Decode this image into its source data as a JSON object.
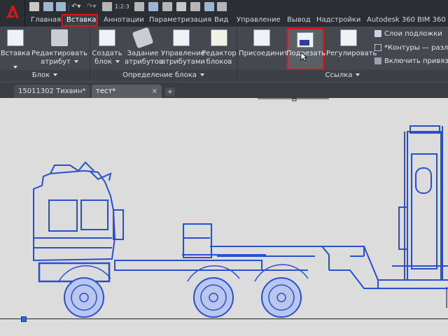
{
  "quick_access": {
    "tool_label": "1:2:3"
  },
  "tabs": [
    {
      "label": "Главная"
    },
    {
      "label": "Вставка"
    },
    {
      "label": "Аннотации"
    },
    {
      "label": "Параметризация"
    },
    {
      "label": "Вид"
    },
    {
      "label": "Управление"
    },
    {
      "label": "Вывод"
    },
    {
      "label": "Надстройки"
    },
    {
      "label": "Autodesk 360"
    },
    {
      "label": "BIM 360"
    }
  ],
  "ribbon": {
    "block_panel": {
      "title": "Блок",
      "buttons": [
        {
          "label1": "Вставка",
          "label2": ""
        },
        {
          "label1": "Редактировать",
          "label2": "атрибут"
        }
      ]
    },
    "block_def_panel": {
      "title": "Определение блока",
      "buttons": [
        {
          "label1": "Создать",
          "label2": "блок"
        },
        {
          "label1": "Задание",
          "label2": "атрибутов"
        },
        {
          "label1": "Управление",
          "label2": "атрибутами"
        },
        {
          "label1": "Редактор",
          "label2": "блоков"
        }
      ]
    },
    "reference_panel": {
      "title": "Ссылка",
      "buttons": [
        {
          "label1": "Присоединить",
          "label2": ""
        },
        {
          "label1": "Подрезать",
          "label2": ""
        },
        {
          "label1": "Регулировать",
          "label2": ""
        }
      ],
      "small_items": [
        {
          "label": "Слои подложки"
        },
        {
          "label": "*Контуры — различ"
        },
        {
          "label": "Включить привязку"
        }
      ]
    }
  },
  "documents": [
    {
      "label": "15011302 Тихвин*"
    },
    {
      "label": "тест*",
      "close": "×"
    }
  ],
  "new_tab": "+",
  "colors": {
    "accent_red": "#e0121b",
    "drawing_blue": "#2a4fd1",
    "ribbon_bg": "#45494f"
  }
}
